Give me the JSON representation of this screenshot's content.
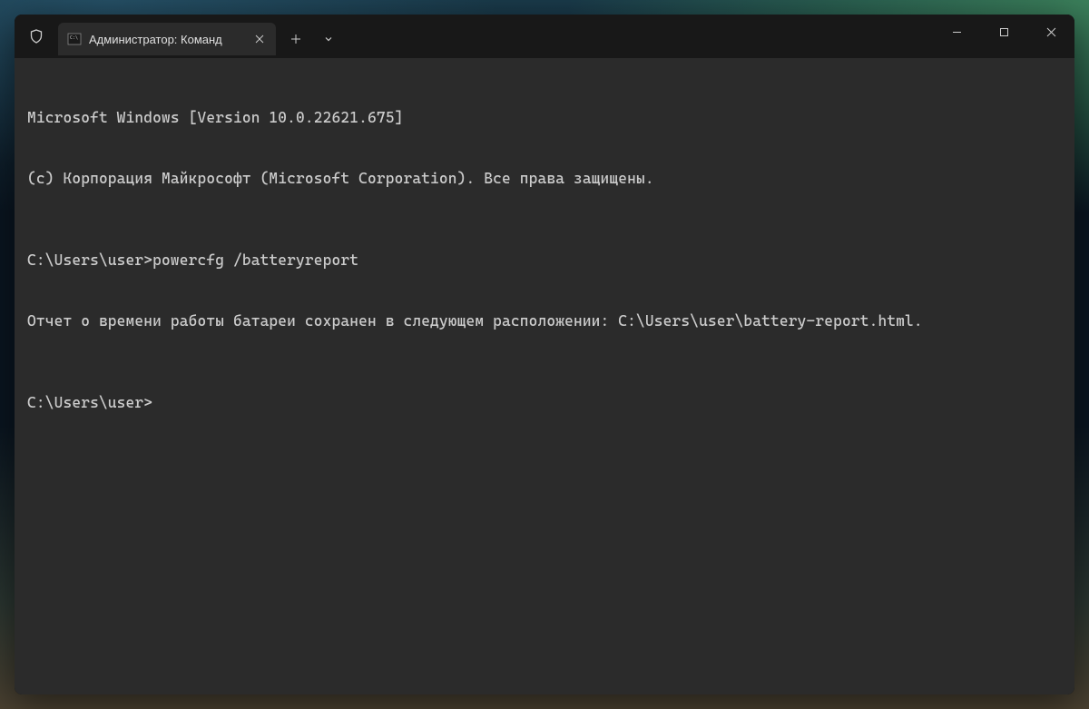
{
  "tab": {
    "title": "Администратор: Команд"
  },
  "terminal": {
    "line1": "Microsoft Windows [Version 10.0.22621.675]",
    "line2": "(c) Корпорация Майкрософт (Microsoft Corporation). Все права защищены.",
    "prompt1": "C:\\Users\\user>",
    "cmd1": "powercfg /batteryreport",
    "output1": "Отчет о времени работы батареи сохранен в следующем расположении: C:\\Users\\user\\battery-report.html.",
    "prompt2": "C:\\Users\\user>"
  }
}
